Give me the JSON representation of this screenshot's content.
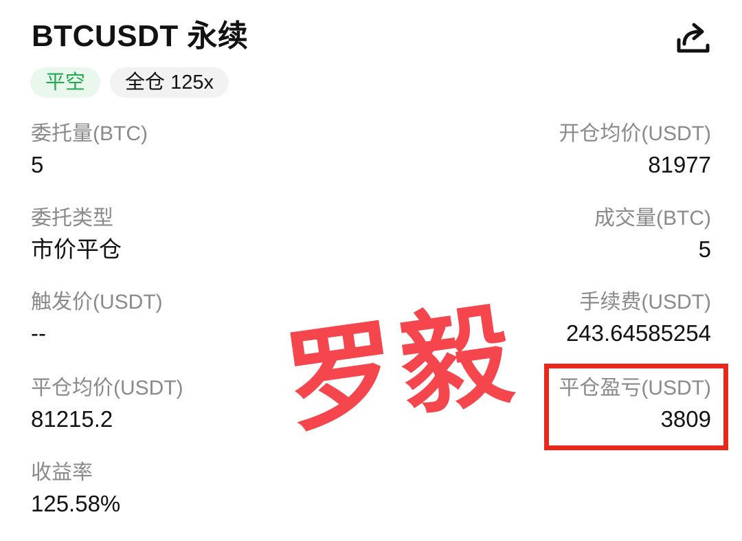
{
  "header": {
    "title": "BTCUSDT 永续",
    "share_icon": "share-icon"
  },
  "badges": {
    "side": "平空",
    "margin": "全仓 125x"
  },
  "fields": {
    "order_qty": {
      "label": "委托量(BTC)",
      "value": "5"
    },
    "open_price": {
      "label": "开仓均价(USDT)",
      "value": "81977"
    },
    "order_type": {
      "label": "委托类型",
      "value": "市价平仓"
    },
    "filled_qty": {
      "label": "成交量(BTC)",
      "value": "5"
    },
    "trigger_price": {
      "label": "触发价(USDT)",
      "value": "--"
    },
    "fee": {
      "label": "手续费(USDT)",
      "value": "243.64585254"
    },
    "close_price": {
      "label": "平仓均价(USDT)",
      "value": "81215.2"
    },
    "close_pnl": {
      "label": "平仓盈亏(USDT)",
      "value": "3809"
    },
    "roi": {
      "label": "收益率",
      "value": "125.58%"
    }
  },
  "overlay": {
    "watermark_text": "罗毅",
    "watermark_color": "#f6464d",
    "highlight_color": "#e8281c"
  },
  "colors": {
    "accent_green": "#1fab4e",
    "text_primary": "#121212",
    "text_secondary": "#8a8a8a"
  }
}
